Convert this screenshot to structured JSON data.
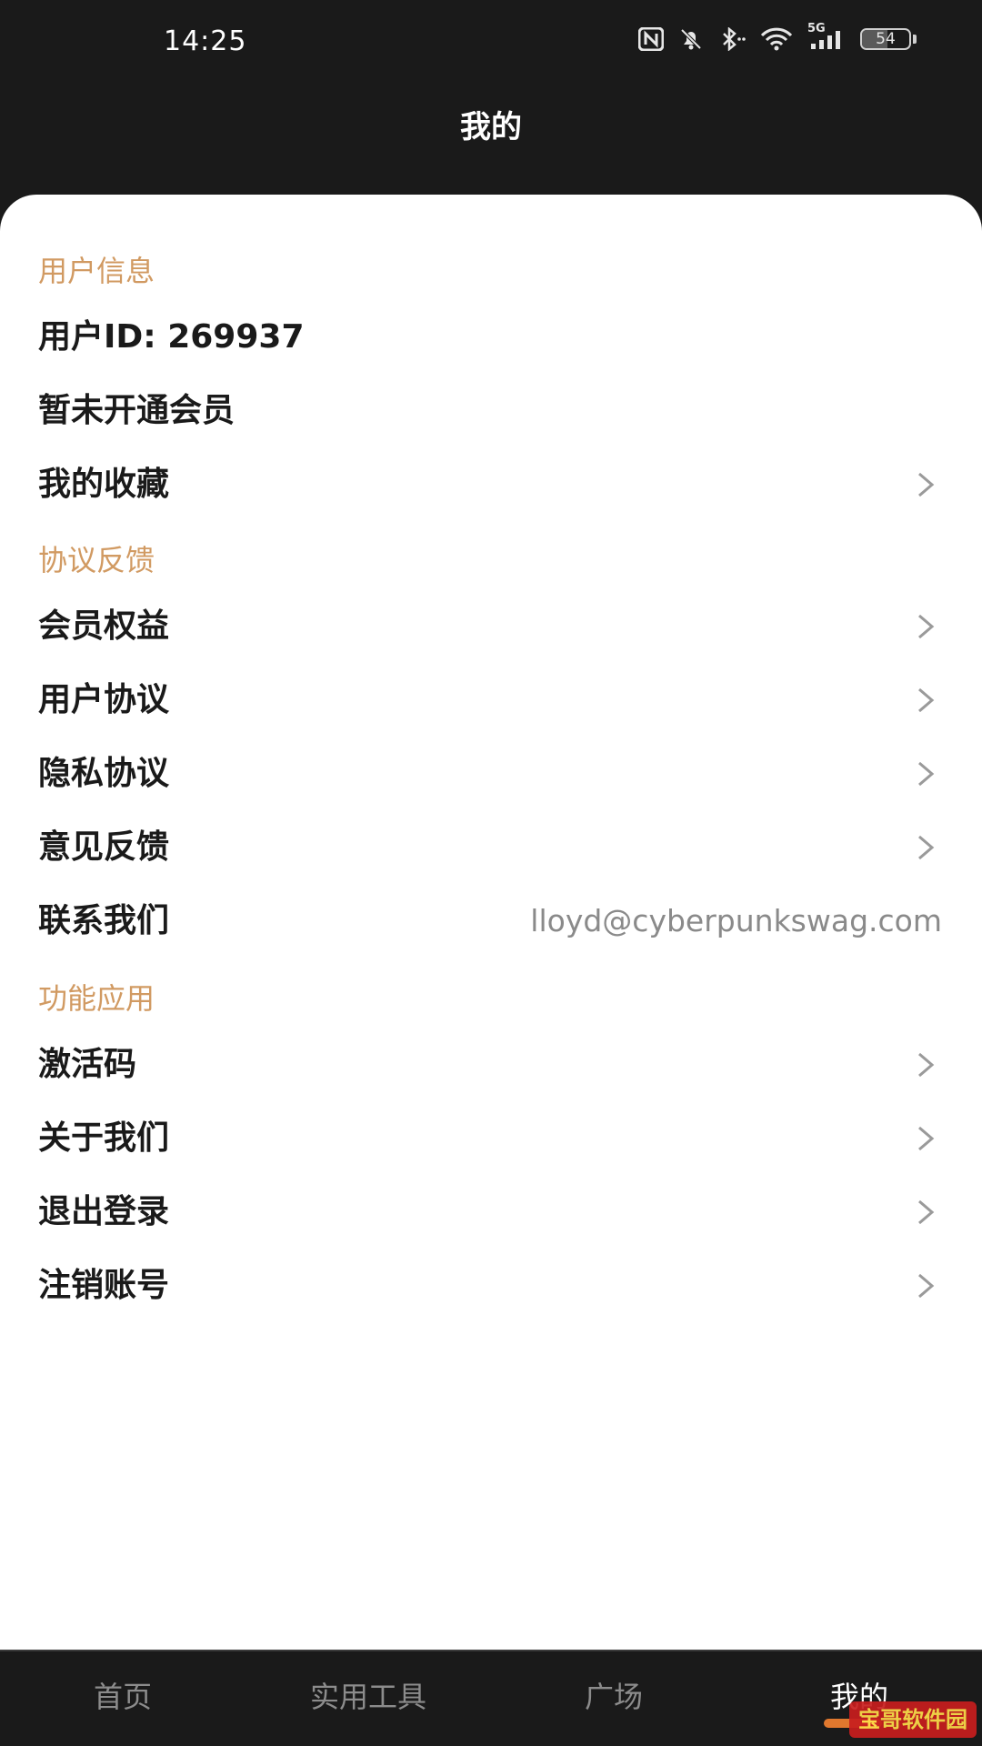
{
  "status_bar": {
    "time": "14:25",
    "network": "5G",
    "battery": 54,
    "icons": [
      "nfc-icon",
      "mute-bell-icon",
      "bluetooth-icon",
      "wifi-icon",
      "signal-icon",
      "battery-icon"
    ]
  },
  "header": {
    "title": "我的"
  },
  "sections": {
    "user_info": "用户信息",
    "agreements": "协议反馈",
    "features": "功能应用"
  },
  "rows": {
    "user_id": "用户ID: 269937",
    "membership_status": "暂未开通会员",
    "favorites": "我的收藏",
    "member_benefits": "会员权益",
    "user_agreement": "用户协议",
    "privacy_agreement": "隐私协议",
    "feedback": "意见反馈",
    "contact_us": "联系我们",
    "contact_email": "lloyd@cyberpunkswag.com",
    "activation_code": "激活码",
    "about_us": "关于我们",
    "logout": "退出登录",
    "delete_account": "注销账号"
  },
  "tabs": [
    {
      "label": "首页",
      "active": false
    },
    {
      "label": "实用工具",
      "active": false
    },
    {
      "label": "广场",
      "active": false
    },
    {
      "label": "我的",
      "active": true
    }
  ],
  "watermark": "宝哥软件园",
  "colors": {
    "background": "#1a1a1a",
    "section_title": "#d19a62",
    "accent": "#e0782e",
    "card": "#ffffff"
  }
}
